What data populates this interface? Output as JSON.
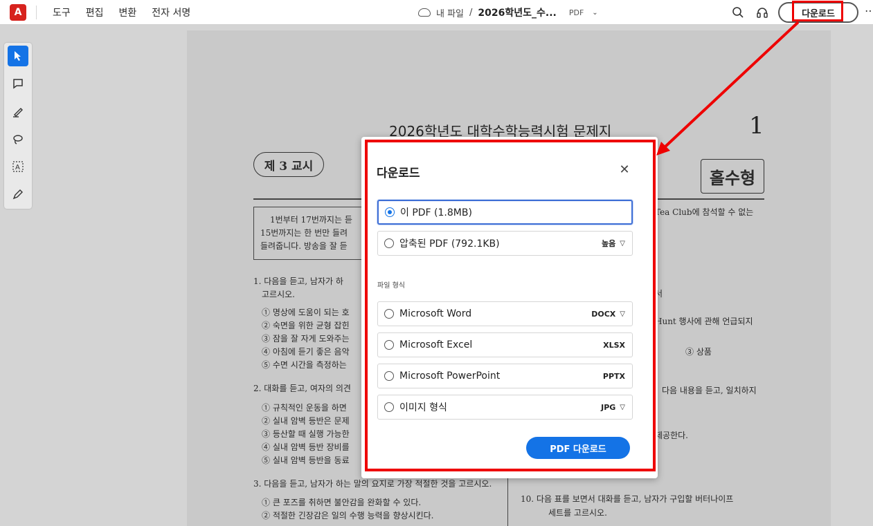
{
  "topbar": {
    "menu": [
      "도구",
      "편집",
      "변환",
      "전자 서명"
    ],
    "breadcrumb_root": "내 파일",
    "breadcrumb_sep": "/",
    "file_name": "2026학년도_수...",
    "file_format": "PDF",
    "download_label": "다운로드"
  },
  "document": {
    "title": "2026학년도 대학수학능력시험 문제지",
    "page_number": "1",
    "session": "제 3 교시",
    "paper_type": "홀수형",
    "lines": [
      "1번부터 17번까지는 듣",
      "15번까지는 한 번만 들려",
      "들려줍니다. 방송을 잘 듣",
      "1. 다음을 듣고, 남자가 하",
      "고르시오.",
      "① 명상에 도움이 되는 호",
      "② 숙면을 위한 균형 잡힌",
      "③ 잠을 잘 자게 도와주는",
      "④ 아침에 듣기 좋은 음악",
      "⑤ 수면 시간을 측정하는",
      "2. 대화를 듣고, 여자의 의견",
      "① 규칙적인 운동을 하면",
      "② 실내 암벽 등반은 문제",
      "③ 등산할 때 실행 가능한",
      "④ 실내 암벽 등반 장비를",
      "⑤ 실내 암벽 등반을 동료",
      "3. 다음을 듣고, 남자가 하는 말의 요지로 가장 적절한 것을 고르시오.",
      "① 큰 포즈를 취하면 불안감을 완화할 수 있다.",
      "② 적절한 긴장감은 일의 수행 능력을 향상시킨다.",
      "Tea Club에 참석할 수 없는",
      "서",
      "Hunt 행사에 관해 언급되지",
      "③ 상품",
      "다음 내용을 듣고, 일치하지",
      "제공한다.",
      "10. 다음 표를 보면서 대화를 듣고, 남자가 구입할 버터나이프",
      "세트를 고르시오."
    ]
  },
  "dialog": {
    "title": "다운로드",
    "close": "✕",
    "options": [
      {
        "label": "이 PDF (1.8MB)",
        "right": "",
        "selected": true
      },
      {
        "label": "압축된 PDF (792.1KB)",
        "right": "높음",
        "selected": false
      }
    ],
    "section_label": "파일 형식",
    "formats": [
      {
        "label": "Microsoft Word",
        "right": "DOCX"
      },
      {
        "label": "Microsoft Excel",
        "right": "XLSX"
      },
      {
        "label": "Microsoft PowerPoint",
        "right": "PPTX"
      },
      {
        "label": "이미지 형식",
        "right": "JPG"
      }
    ],
    "primary_button": "PDF 다운로드"
  },
  "colors": {
    "accent": "#1473e6",
    "highlight": "#e00000",
    "logo": "#d7231e"
  }
}
